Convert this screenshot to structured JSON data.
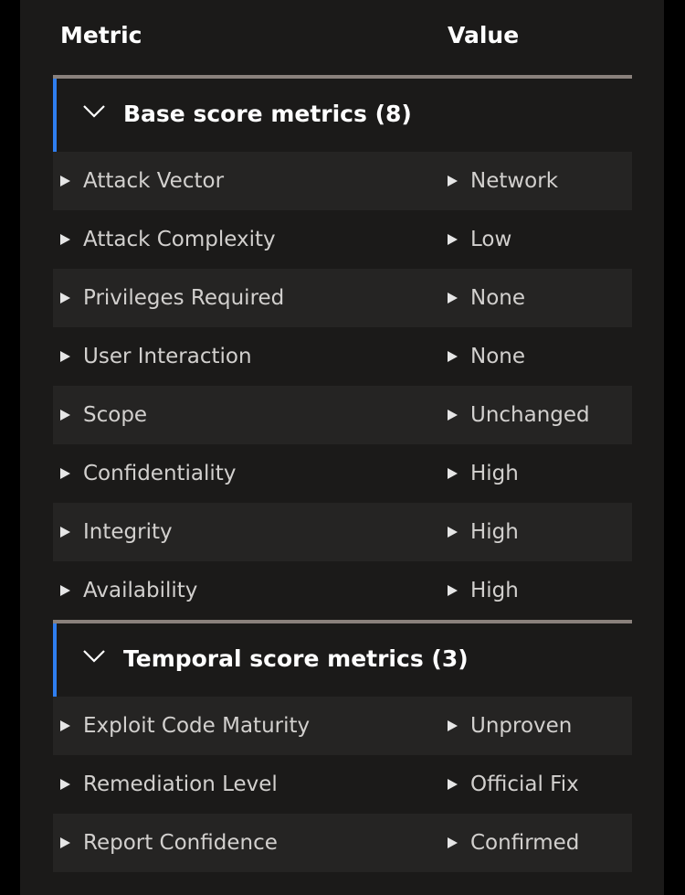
{
  "columns": {
    "metric": "Metric",
    "value": "Value"
  },
  "groups": [
    {
      "title": "Base score metrics (8)",
      "rows": [
        {
          "metric": "Attack Vector",
          "value": "Network"
        },
        {
          "metric": "Attack Complexity",
          "value": "Low"
        },
        {
          "metric": "Privileges Required",
          "value": "None"
        },
        {
          "metric": "User Interaction",
          "value": "None"
        },
        {
          "metric": "Scope",
          "value": "Unchanged"
        },
        {
          "metric": "Confidentiality",
          "value": "High"
        },
        {
          "metric": "Integrity",
          "value": "High"
        },
        {
          "metric": "Availability",
          "value": "High"
        }
      ]
    },
    {
      "title": "Temporal score metrics (3)",
      "rows": [
        {
          "metric": "Exploit Code Maturity",
          "value": "Unproven"
        },
        {
          "metric": "Remediation Level",
          "value": "Official Fix"
        },
        {
          "metric": "Report Confidence",
          "value": "Confirmed"
        }
      ]
    }
  ],
  "icons": {
    "group_toggle": "chevron-down-icon",
    "row_toggle": "triangle-right-icon"
  },
  "colors": {
    "panel_bg": "#1b1a19",
    "row_alt_bg": "#252423",
    "group_accent": "#2f7ef0",
    "separator": "#8a817c"
  }
}
